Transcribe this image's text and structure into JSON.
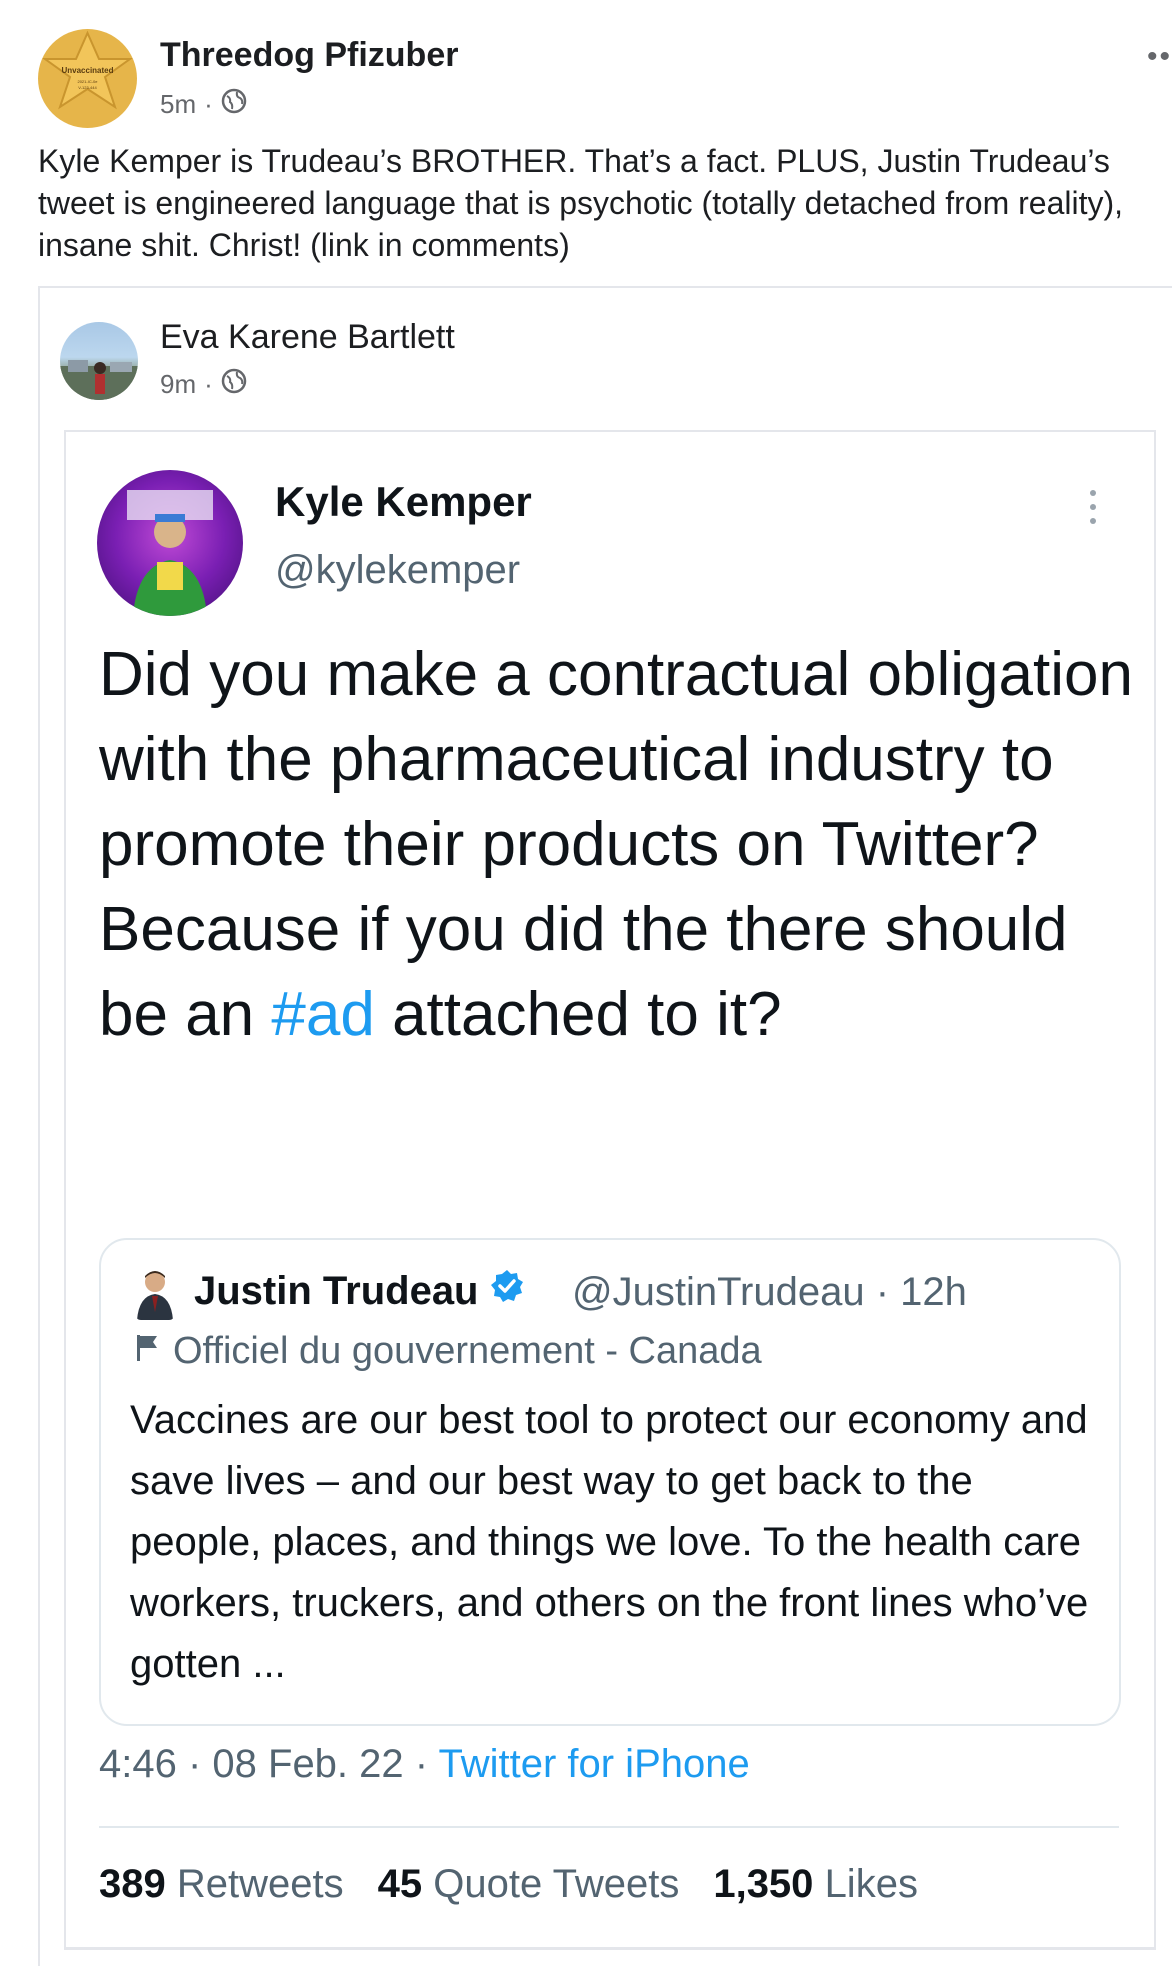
{
  "post": {
    "author": "Threedog Pfizuber",
    "time": "5m",
    "separator": "·",
    "text": "Kyle Kemper is Trudeau’s BROTHER. That’s a fact. PLUS, Justin Trudeau’s tweet is engineered language that is psychotic (totally detached from reality), insane shit. Christ! (link in comments)",
    "avatar_badge": "Unvaccinated",
    "avatar_badge_lines": [
      "2021-IC-0e",
      "V-123-444"
    ]
  },
  "shared": {
    "author": "Eva Karene Bartlett",
    "time": "9m",
    "separator": "·"
  },
  "tweet": {
    "name": "Kyle Kemper",
    "handle": "@kylekemper",
    "body_before": "Did you make a contractual obligation with the pharmaceutical industry to promote their products on Twitter? Because if you did the there should be an ",
    "hashtag": "#ad",
    "body_after": " attached to it?",
    "timestamp": "4:46 · 08 Feb. 22 · ",
    "source": "Twitter for iPhone",
    "stats": [
      {
        "count": "389",
        "label": "Retweets"
      },
      {
        "count": "45",
        "label": "Quote Tweets"
      },
      {
        "count": "1,350",
        "label": "Likes"
      }
    ]
  },
  "quote": {
    "name": "Justin Trudeau",
    "handle": "@JustinTrudeau · 12h",
    "label": "Officiel du gouvernement - Canada",
    "text": "Vaccines are our best tool to protect our economy and save lives – and our best way to get back to the people, places, and things we love. To the health care workers, truckers, and others on the front lines who’ve gotten ..."
  },
  "colors": {
    "twitter_blue": "#1d9bf0",
    "muted_gray": "#536471",
    "badge_gold": "#e6b54a"
  }
}
